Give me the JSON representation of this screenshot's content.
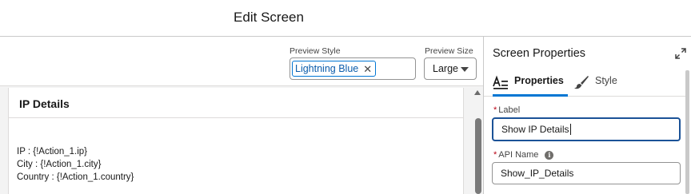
{
  "header": {
    "title": "Edit Screen"
  },
  "toolbar": {
    "preview_style_label": "Preview Style",
    "preview_style_value": "Lightning Blue",
    "preview_size_label": "Preview Size",
    "preview_size_value": "Large"
  },
  "screen": {
    "title": "IP Details",
    "lines": [
      "IP : {!Action_1.ip}",
      "City : {!Action_1.city}",
      "Country : {!Action_1.country}"
    ]
  },
  "properties": {
    "title": "Screen Properties",
    "tabs": [
      {
        "label": "Properties",
        "icon": "properties-icon",
        "active": true
      },
      {
        "label": "Style",
        "icon": "paintbrush-icon",
        "active": false
      }
    ],
    "label_field": {
      "label": "Label",
      "required_mark": "*",
      "value": "Show IP Details"
    },
    "api_field": {
      "label": "API Name",
      "required_mark": "*",
      "value": "Show_IP_Details"
    }
  },
  "colors": {
    "accent": "#0176d3",
    "focus_border": "#1b5297",
    "required": "#ba0517"
  }
}
